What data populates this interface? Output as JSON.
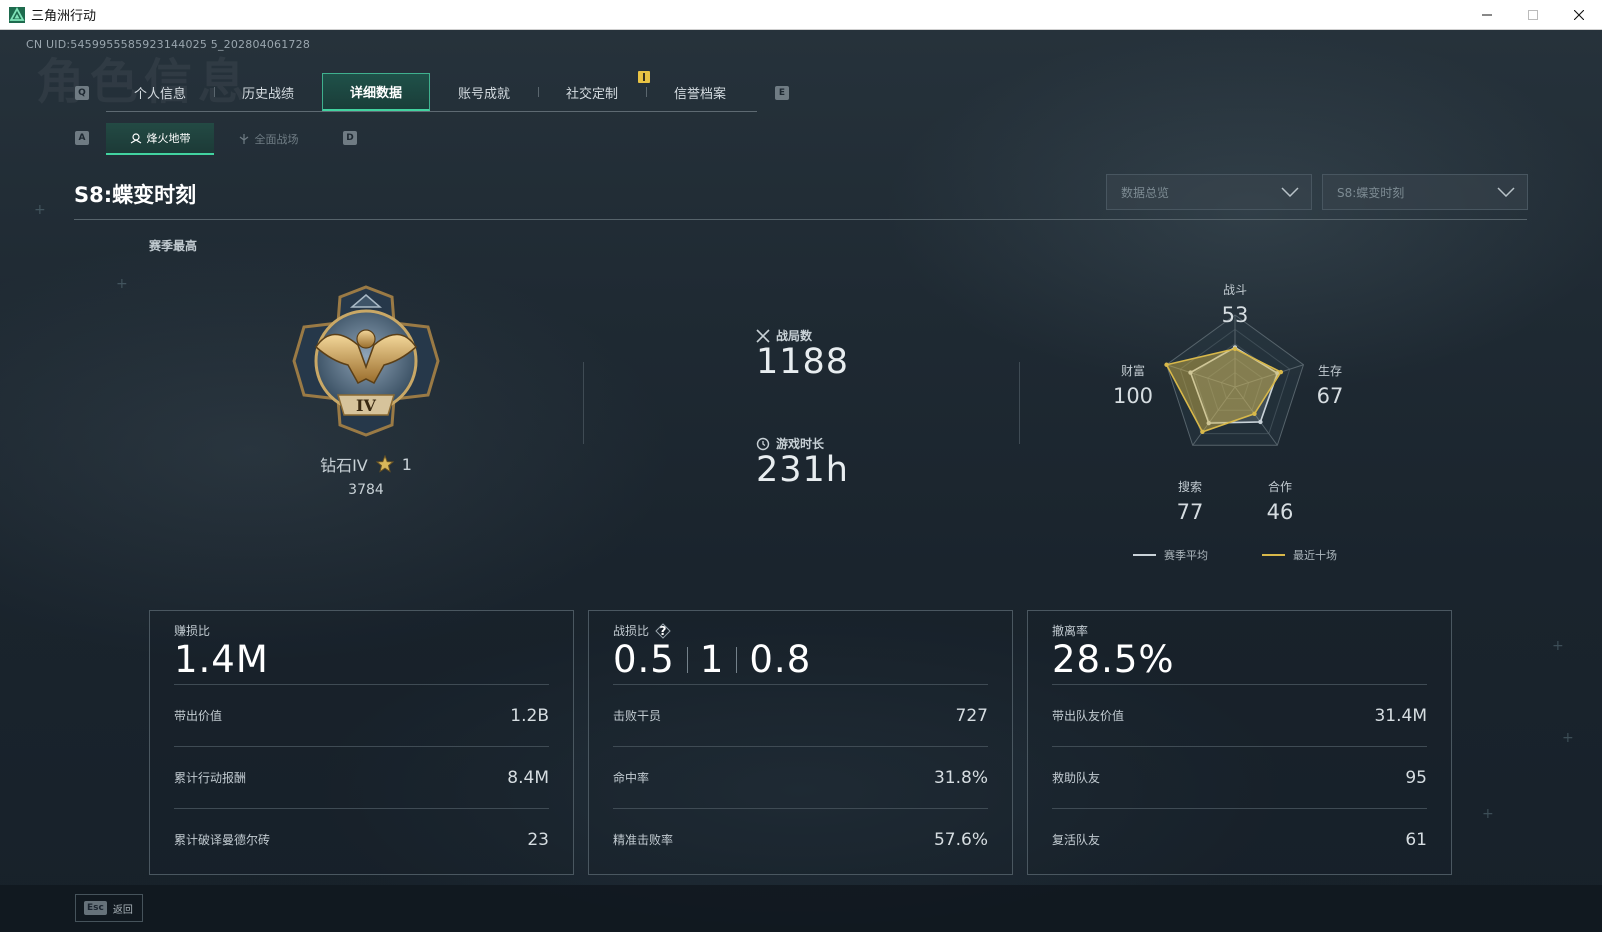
{
  "window": {
    "title": "三角洲行动"
  },
  "uid": "CN UID:5459955585923144025 5_202804061728",
  "ghost_title": "角色信息",
  "keyhints": {
    "prev_tab": "Q",
    "next_tab": "E",
    "prev_sub": "A",
    "next_sub": "D"
  },
  "tabs": [
    {
      "label": "个人信息",
      "active": false
    },
    {
      "label": "历史战绩",
      "active": false
    },
    {
      "label": "详细数据",
      "active": true
    },
    {
      "label": "账号成就",
      "active": false
    },
    {
      "label": "社交定制",
      "active": false
    },
    {
      "label": "信誉档案",
      "active": false
    }
  ],
  "subtabs": [
    {
      "label": "烽火地带",
      "active": true
    },
    {
      "label": "全面战场",
      "active": false
    }
  ],
  "season": {
    "title": "S8:蝶变时刻"
  },
  "dropdowns": {
    "view": "数据总览",
    "season": "S8:蝶变时刻"
  },
  "season_high": {
    "label": "赛季最高",
    "rank": "钻石IV",
    "stars": "1",
    "points": "3784",
    "badge_numeral": "IV"
  },
  "matches": {
    "label": "战局数",
    "value": "1188"
  },
  "playtime": {
    "label": "游戏时长",
    "value": "231h"
  },
  "radar": {
    "labels": [
      "战斗",
      "生存",
      "合作",
      "搜索",
      "财富"
    ],
    "values": [
      "53",
      "67",
      "46",
      "77",
      "100"
    ],
    "season_avg": [
      55,
      62,
      60,
      62,
      65
    ],
    "recent_ten": [
      53,
      67,
      46,
      77,
      100
    ],
    "legend_season": "赛季平均",
    "legend_recent": "最近十场",
    "color_season": "#c9d2d8",
    "color_recent": "#d8b84a"
  },
  "cards": [
    {
      "label": "赚损比",
      "value": "1.4M",
      "rows": [
        {
          "label": "带出价值",
          "value": "1.2B"
        },
        {
          "label": "累计行动报酬",
          "value": "8.4M"
        },
        {
          "label": "累计破译曼德尔砖",
          "value": "23"
        }
      ]
    },
    {
      "label": "战损比",
      "values": [
        "0.5",
        "1",
        "0.8"
      ],
      "rows": [
        {
          "label": "击败干员",
          "value": "727"
        },
        {
          "label": "命中率",
          "value": "31.8%"
        },
        {
          "label": "精准击败率",
          "value": "57.6%"
        }
      ]
    },
    {
      "label": "撤离率",
      "value": "28.5%",
      "rows": [
        {
          "label": "带出队友价值",
          "value": "31.4M"
        },
        {
          "label": "救助队友",
          "value": "95"
        },
        {
          "label": "复活队友",
          "value": "61"
        }
      ]
    }
  ],
  "footer": {
    "esc_key": "Esc",
    "back_label": "返回"
  }
}
